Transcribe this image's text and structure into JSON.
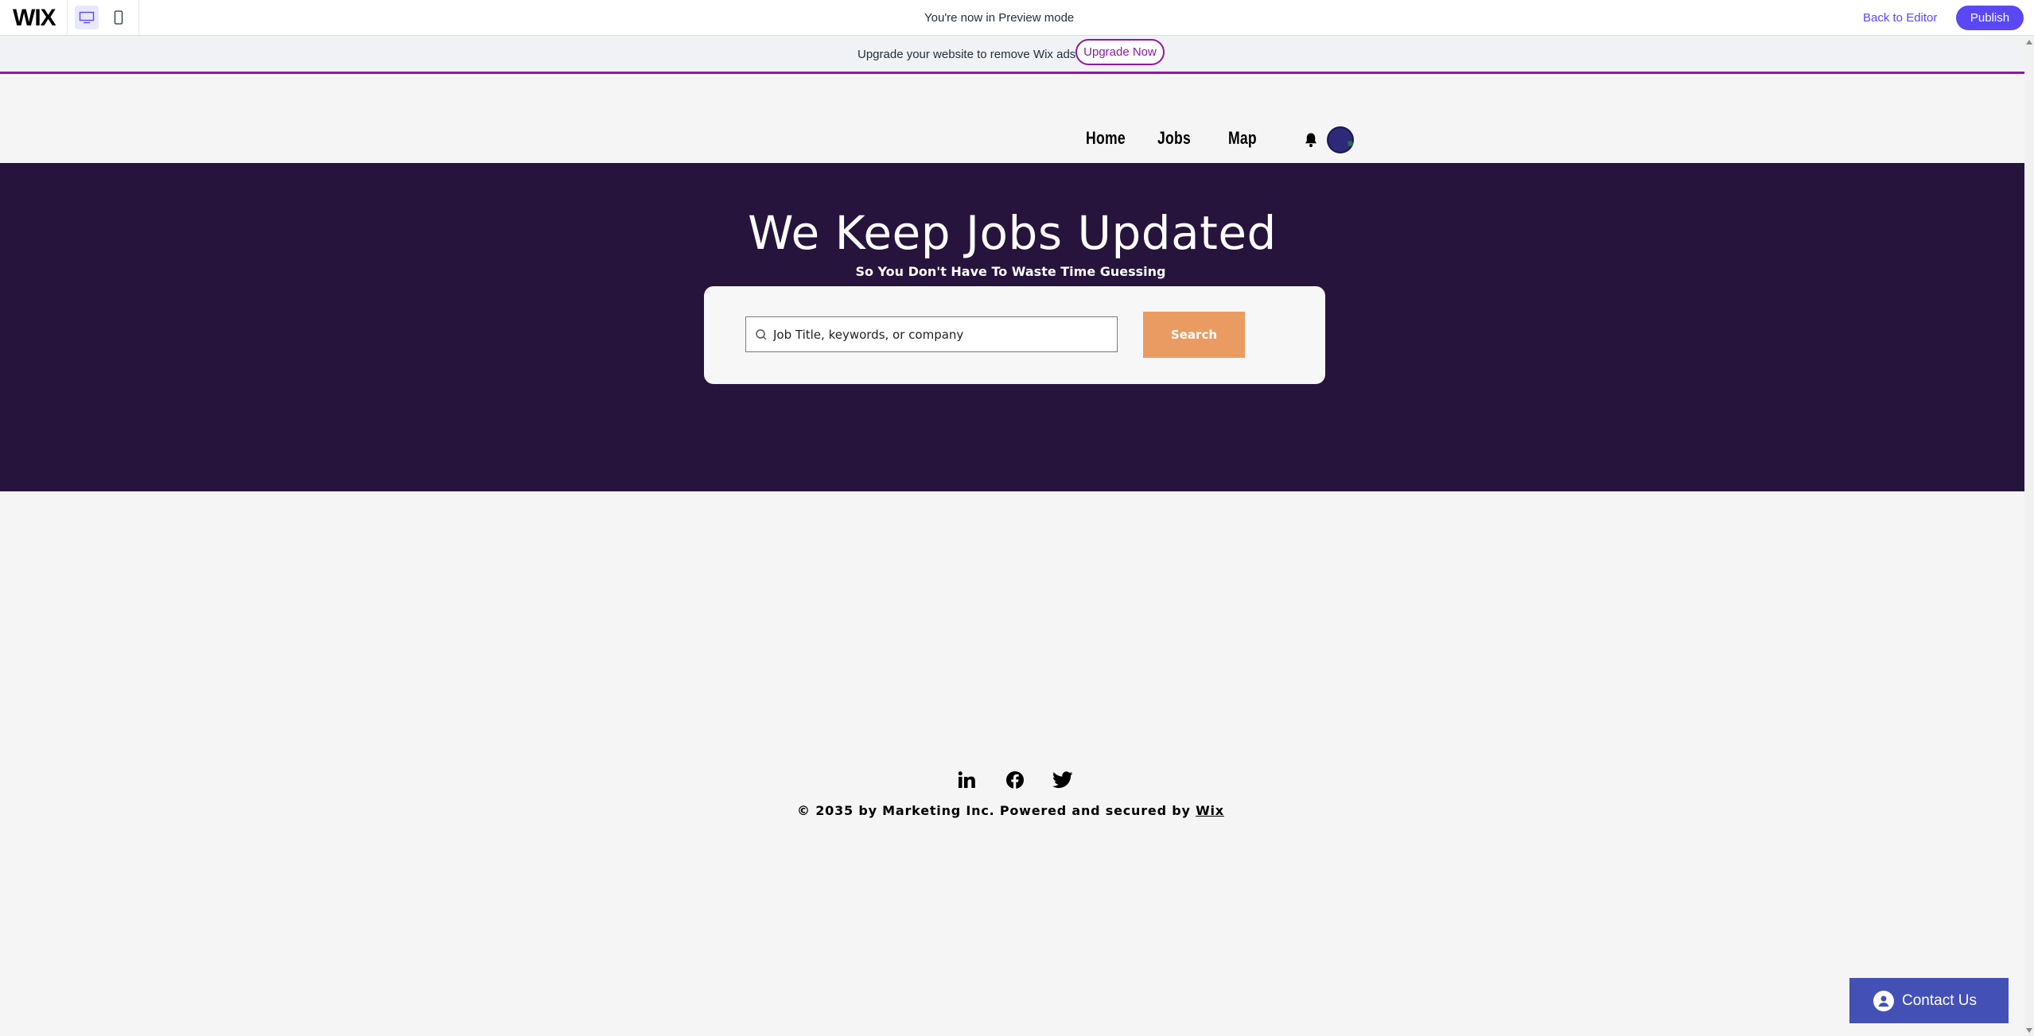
{
  "wix_bar": {
    "logo": "WIX",
    "preview_text": "You're now in Preview mode",
    "back_to_editor": "Back to Editor",
    "publish": "Publish"
  },
  "upgrade_bar": {
    "text": "Upgrade your website to remove Wix ads",
    "button": "Upgrade Now"
  },
  "nav": {
    "items": [
      "Home",
      "Jobs",
      "Map"
    ]
  },
  "hero": {
    "title": "We Keep Jobs Updated",
    "subtitle": "So You Don't Have To Waste Time Guessing",
    "search_placeholder": "Job Title, keywords, or company",
    "search_button": "Search"
  },
  "footer": {
    "copyright": "© 2035 by Marketing Inc. Powered and secured by ",
    "link": "Wix",
    "social": [
      "linkedin-icon",
      "facebook-icon",
      "twitter-icon"
    ]
  },
  "contact": {
    "label": "Contact Us"
  },
  "colors": {
    "hero_bg": "#26143d",
    "search_button": "#e99b61",
    "publish": "#5a48f5",
    "upgrade_accent": "#8a1aa0",
    "contact_bg": "#4350b5"
  }
}
